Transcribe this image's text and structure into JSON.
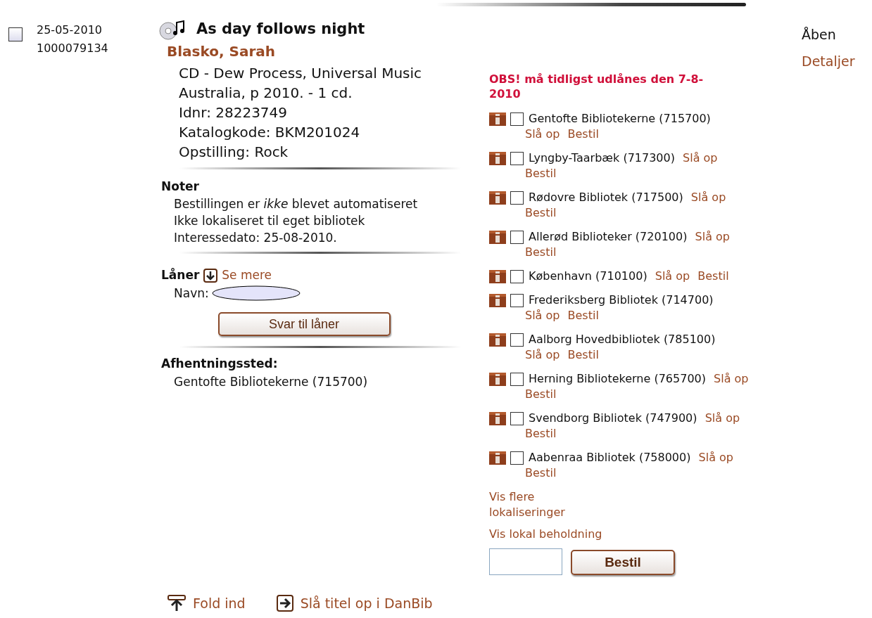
{
  "order": {
    "checked": false,
    "date": "25-05-2010",
    "number": "1000079134"
  },
  "record": {
    "title": "As day follows night",
    "author": "Blasko, Sarah",
    "details": [
      "CD - Dew Process, Universal Music Australia, p 2010. - 1 cd.",
      "Idnr: 28223749",
      "Katalogkode: BKM201024",
      "Opstilling: Rock"
    ]
  },
  "notes": {
    "heading": "Noter",
    "items": [
      "Bestillingen er *ikke* blevet automatiseret",
      "Ikke lokaliseret til eget bibliotek",
      "Interessedato: 25-08-2010."
    ]
  },
  "borrower": {
    "heading": "Låner",
    "more_link": "Se mere",
    "name_label": "Navn:",
    "reply_button": "Svar til låner"
  },
  "pickup": {
    "heading": "Afhentningssted:",
    "value": "Gentofte Bibliotekerne (715700)"
  },
  "notice": "OBS! må tidligst udlånes den 7-8-2010",
  "libraries": [
    {
      "name": "Gentofte Bibliotekerne (715700)",
      "checked": false,
      "lookup": "Slå op",
      "order": "Bestil"
    },
    {
      "name": "Lyngby-Taarbæk (717300)",
      "checked": false,
      "lookup": "Slå op",
      "order": "Bestil"
    },
    {
      "name": "Rødovre Bibliotek (717500)",
      "checked": false,
      "lookup": "Slå op",
      "order": "Bestil"
    },
    {
      "name": "Allerød Biblioteker (720100)",
      "checked": false,
      "lookup": "Slå op",
      "order": "Bestil"
    },
    {
      "name": "København (710100)",
      "checked": false,
      "lookup": "Slå op",
      "order": "Bestil"
    },
    {
      "name": "Frederiksberg Bibliotek (714700)",
      "checked": false,
      "lookup": "Slå op",
      "order": "Bestil"
    },
    {
      "name": "Aalborg Hovedbibliotek (785100)",
      "checked": false,
      "lookup": "Slå op",
      "order": "Bestil"
    },
    {
      "name": "Herning Bibliotekerne (765700)",
      "checked": false,
      "lookup": "Slå op",
      "order": "Bestil"
    },
    {
      "name": "Svendborg Bibliotek (747900)",
      "checked": false,
      "lookup": "Slå op",
      "order": "Bestil"
    },
    {
      "name": "Aabenraa Bibliotek (758000)",
      "checked": false,
      "lookup": "Slå op",
      "order": "Bestil"
    }
  ],
  "more_locations": "Vis flere lokaliseringer",
  "local_holdings": "Vis lokal beholdning",
  "order_button": "Bestil",
  "status": {
    "state": "Åben",
    "details_link": "Detaljer"
  },
  "footer": {
    "collapse": "Fold ind",
    "lookup_title": "Slå titel op i DanBib"
  }
}
